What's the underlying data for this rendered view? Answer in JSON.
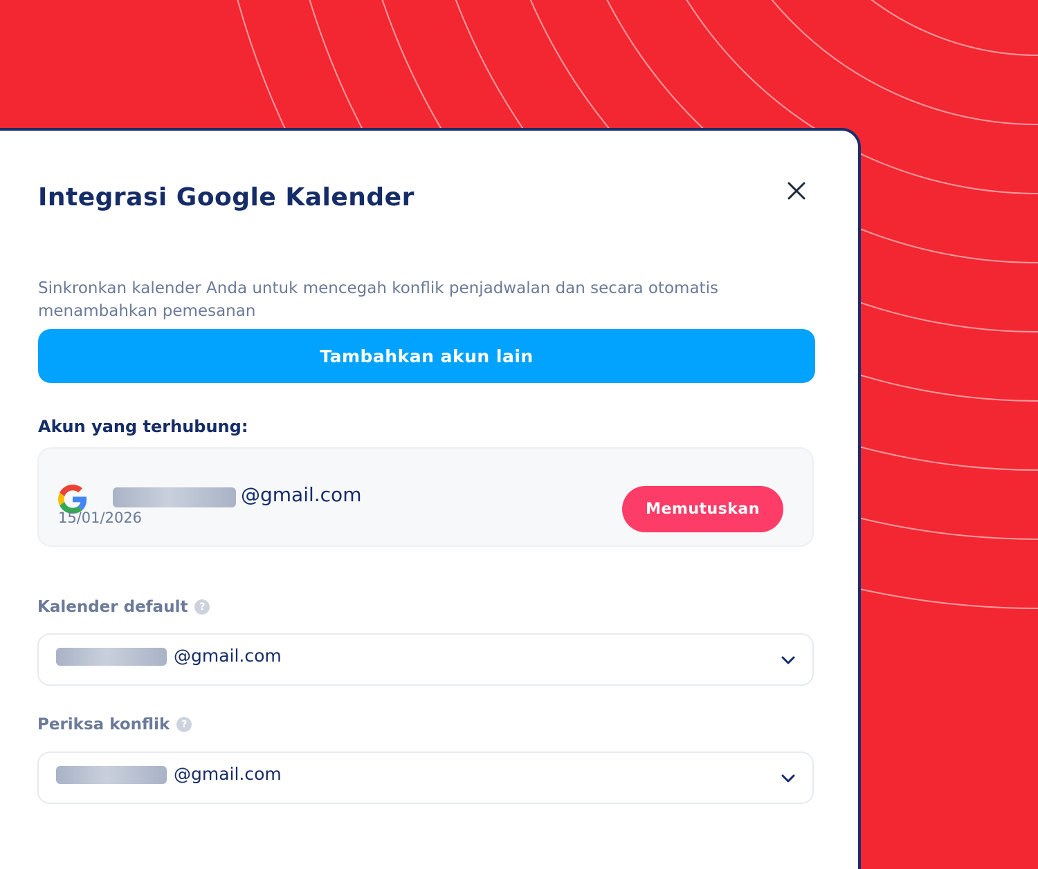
{
  "modal": {
    "title": "Integrasi Google Kalender",
    "description": "Sinkronkan kalender Anda untuk mencegah konflik penjadwalan dan secara otomatis menambahkan pemesanan",
    "add_account_label": "Tambahkan akun lain",
    "connected_label": "Akun yang terhubung:"
  },
  "connected_account": {
    "email_suffix": "@gmail.com",
    "date": "15/01/2026",
    "disconnect_label": "Memutuskan"
  },
  "default_calendar": {
    "label": "Kalender default",
    "help": "?",
    "value_suffix": "@gmail.com"
  },
  "conflict_check": {
    "label": "Periksa konflik",
    "help": "?",
    "value_suffix": "@gmail.com"
  },
  "colors": {
    "background": "#f32732",
    "title": "#152c68",
    "primary_button": "#02a2ff",
    "disconnect_button": "#fd3c68",
    "muted_text": "#6b7a99"
  },
  "icons": {
    "close": "close-icon",
    "google": "google-icon",
    "help": "help-icon",
    "chevron": "chevron-down-icon"
  }
}
